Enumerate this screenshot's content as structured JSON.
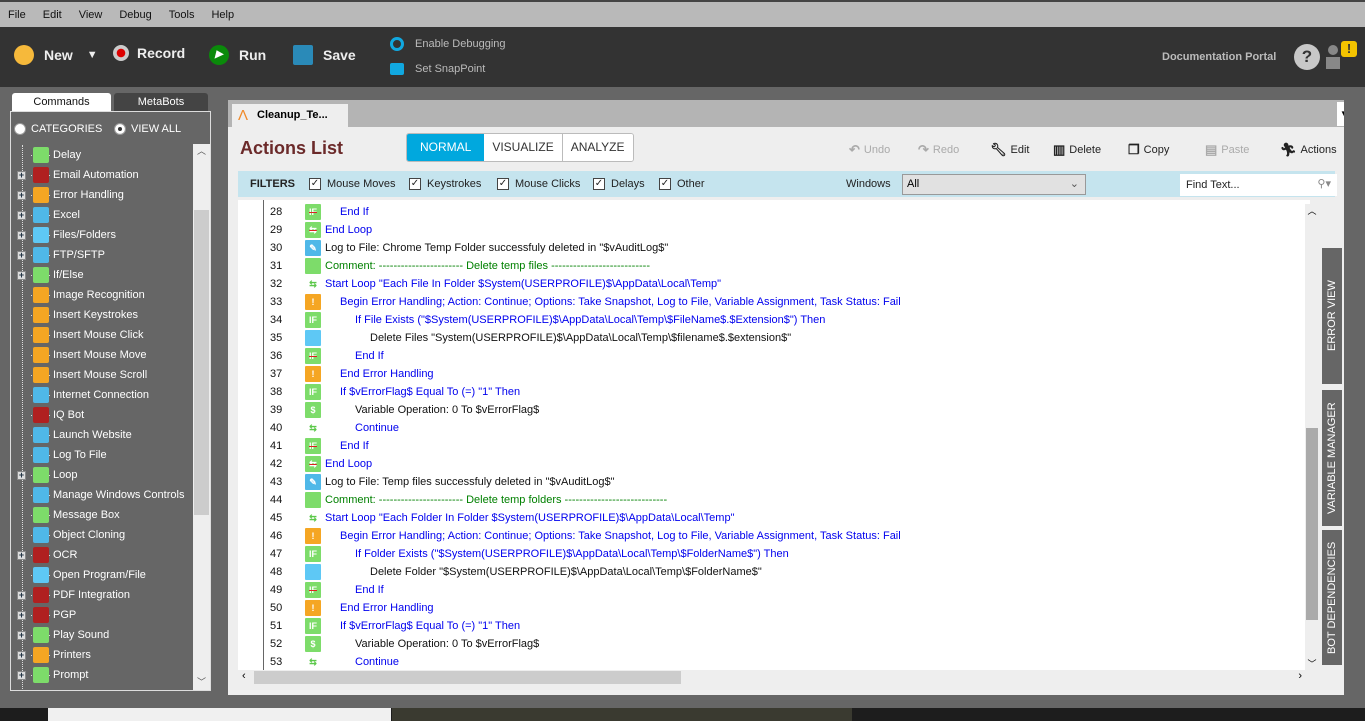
{
  "menu": [
    "File",
    "Edit",
    "View",
    "Debug",
    "Tools",
    "Help"
  ],
  "toolbar": {
    "new": "New",
    "record": "Record",
    "run": "Run",
    "save": "Save",
    "enable_debugging": "Enable Debugging",
    "set_snappoint": "Set SnapPoint",
    "doc_portal": "Documentation Portal",
    "help": "?",
    "alert": "!"
  },
  "left": {
    "tabs": [
      "Commands",
      "MetaBots"
    ],
    "radio_categories": "CATEGORIES",
    "radio_viewall": "VIEW ALL",
    "items": [
      {
        "label": "Delay",
        "exp": false,
        "color": "#7ddc6a"
      },
      {
        "label": "Email Automation",
        "exp": true,
        "color": "#b02020"
      },
      {
        "label": "Error Handling",
        "exp": true,
        "color": "#f5a623"
      },
      {
        "label": "Excel",
        "exp": true,
        "color": "#4fb8e8"
      },
      {
        "label": "Files/Folders",
        "exp": true,
        "color": "#5ec8f5"
      },
      {
        "label": "FTP/SFTP",
        "exp": true,
        "color": "#4fb8e8"
      },
      {
        "label": "If/Else",
        "exp": true,
        "color": "#7ddc6a"
      },
      {
        "label": "Image Recognition",
        "exp": false,
        "color": "#f5a623"
      },
      {
        "label": "Insert Keystrokes",
        "exp": false,
        "color": "#f5a623"
      },
      {
        "label": "Insert Mouse Click",
        "exp": false,
        "color": "#f5a623"
      },
      {
        "label": "Insert Mouse Move",
        "exp": false,
        "color": "#f5a623"
      },
      {
        "label": "Insert Mouse Scroll",
        "exp": false,
        "color": "#f5a623"
      },
      {
        "label": "Internet Connection",
        "exp": false,
        "color": "#4fb8e8"
      },
      {
        "label": "IQ Bot",
        "exp": false,
        "color": "#b02020"
      },
      {
        "label": "Launch Website",
        "exp": false,
        "color": "#4fb8e8"
      },
      {
        "label": "Log To File",
        "exp": false,
        "color": "#4fb8e8"
      },
      {
        "label": "Loop",
        "exp": true,
        "color": "#7ddc6a"
      },
      {
        "label": "Manage Windows Controls",
        "exp": false,
        "color": "#4fb8e8"
      },
      {
        "label": "Message Box",
        "exp": false,
        "color": "#7ddc6a"
      },
      {
        "label": "Object Cloning",
        "exp": false,
        "color": "#4fb8e8"
      },
      {
        "label": "OCR",
        "exp": true,
        "color": "#b02020"
      },
      {
        "label": "Open Program/File",
        "exp": false,
        "color": "#5ec8f5"
      },
      {
        "label": "PDF Integration",
        "exp": true,
        "color": "#b02020"
      },
      {
        "label": "PGP",
        "exp": true,
        "color": "#b02020"
      },
      {
        "label": "Play Sound",
        "exp": true,
        "color": "#7ddc6a"
      },
      {
        "label": "Printers",
        "exp": true,
        "color": "#f5a623"
      },
      {
        "label": "Prompt",
        "exp": true,
        "color": "#7ddc6a"
      }
    ]
  },
  "main": {
    "doc_tab": "Cleanup_Te...",
    "title": "Actions List",
    "modes": [
      "NORMAL",
      "VISUALIZE",
      "ANALYZE"
    ],
    "actions": {
      "undo": "Undo",
      "redo": "Redo",
      "edit": "Edit",
      "delete": "Delete",
      "copy": "Copy",
      "paste": "Paste",
      "actions": "Actions"
    },
    "filters_label": "FILTERS",
    "filters": [
      "Mouse Moves",
      "Keystrokes",
      "Mouse Clicks",
      "Delays",
      "Other"
    ],
    "windows_label": "Windows",
    "windows_value": "All",
    "find_placeholder": "Find Text...",
    "side_tabs": [
      "ERROR VIEW",
      "VARIABLE MANAGER",
      "BOT DEPENDENCIES"
    ],
    "rows": [
      {
        "n": "28",
        "ind": 1,
        "ic": "endif",
        "c": "b",
        "t": "End If"
      },
      {
        "n": "29",
        "ind": 0,
        "ic": "endloop",
        "c": "b",
        "t": "End Loop"
      },
      {
        "n": "30",
        "ind": 0,
        "ic": "log",
        "c": "k",
        "t": "Log to File: Chrome Temp Folder successfuly deleted in \"$vAuditLog$\""
      },
      {
        "n": "31",
        "ind": 0,
        "ic": "comment",
        "c": "g",
        "t": "Comment: ----------------------- Delete temp files ---------------------------"
      },
      {
        "n": "32",
        "ind": 0,
        "ic": "loop",
        "c": "b",
        "t": "Start Loop \"Each File In Folder $System(USERPROFILE)$\\AppData\\Local\\Temp\""
      },
      {
        "n": "33",
        "ind": 1,
        "ic": "error",
        "c": "b",
        "t": "Begin Error Handling; Action: Continue; Options: Take Snapshot, Log to File, Variable Assignment,  Task Status: Fail"
      },
      {
        "n": "34",
        "ind": 2,
        "ic": "if",
        "c": "b",
        "t": "If File Exists (\"$System(USERPROFILE)$\\AppData\\Local\\Temp\\$FileName$.$Extension$\")  Then"
      },
      {
        "n": "35",
        "ind": 3,
        "ic": "folder",
        "c": "k",
        "t": "Delete Files \"System(USERPROFILE)$\\AppData\\Local\\Temp\\$filename$.$extension$\""
      },
      {
        "n": "36",
        "ind": 2,
        "ic": "endif",
        "c": "b",
        "t": "End If"
      },
      {
        "n": "37",
        "ind": 1,
        "ic": "error",
        "c": "b",
        "t": "End Error Handling"
      },
      {
        "n": "38",
        "ind": 1,
        "ic": "if",
        "c": "b",
        "t": "If $vErrorFlag$ Equal To (=) \"1\" Then"
      },
      {
        "n": "39",
        "ind": 2,
        "ic": "var",
        "c": "k",
        "t": "Variable Operation: 0 To $vErrorFlag$"
      },
      {
        "n": "40",
        "ind": 2,
        "ic": "continue",
        "c": "b",
        "t": "Continue"
      },
      {
        "n": "41",
        "ind": 1,
        "ic": "endif",
        "c": "b",
        "t": "End If"
      },
      {
        "n": "42",
        "ind": 0,
        "ic": "endloop",
        "c": "b",
        "t": "End Loop"
      },
      {
        "n": "43",
        "ind": 0,
        "ic": "log",
        "c": "k",
        "t": "Log to File: Temp files successfuly deleted in \"$vAuditLog$\""
      },
      {
        "n": "44",
        "ind": 0,
        "ic": "comment",
        "c": "g",
        "t": "Comment: ----------------------- Delete temp folders ----------------------------"
      },
      {
        "n": "45",
        "ind": 0,
        "ic": "loop",
        "c": "b",
        "t": "Start Loop \"Each Folder In Folder $System(USERPROFILE)$\\AppData\\Local\\Temp\""
      },
      {
        "n": "46",
        "ind": 1,
        "ic": "error",
        "c": "b",
        "t": "Begin Error Handling; Action: Continue; Options: Take Snapshot, Log to File, Variable Assignment,  Task Status: Fail"
      },
      {
        "n": "47",
        "ind": 2,
        "ic": "if",
        "c": "b",
        "t": "If Folder Exists (\"$System(USERPROFILE)$\\AppData\\Local\\Temp\\$FolderName$\")  Then"
      },
      {
        "n": "48",
        "ind": 3,
        "ic": "folder",
        "c": "k",
        "t": "Delete Folder \"$System(USERPROFILE)$\\AppData\\Local\\Temp\\$FolderName$\""
      },
      {
        "n": "49",
        "ind": 2,
        "ic": "endif",
        "c": "b",
        "t": "End If"
      },
      {
        "n": "50",
        "ind": 1,
        "ic": "error",
        "c": "b",
        "t": "End Error Handling"
      },
      {
        "n": "51",
        "ind": 1,
        "ic": "if",
        "c": "b",
        "t": "If $vErrorFlag$ Equal To (=) \"1\" Then"
      },
      {
        "n": "52",
        "ind": 2,
        "ic": "var",
        "c": "k",
        "t": "Variable Operation: 0 To $vErrorFlag$"
      },
      {
        "n": "53",
        "ind": 2,
        "ic": "continue",
        "c": "b",
        "t": "Continue"
      }
    ]
  },
  "colors": {
    "accent": "#00a8de",
    "title": "#6b2a2a",
    "filter_bar": "#c5e4ee",
    "blue_text": "#0000ee",
    "green_text": "#008000"
  }
}
